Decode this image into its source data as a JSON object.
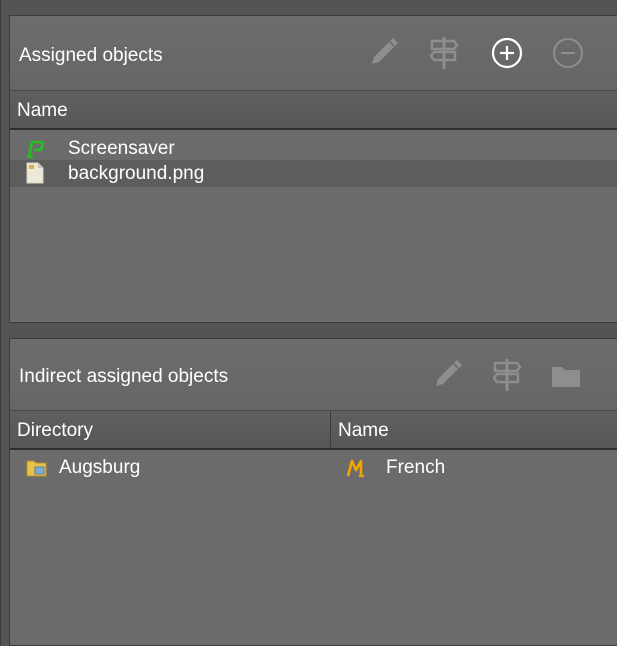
{
  "assigned": {
    "title": "Assigned objects",
    "column_name": "Name",
    "toolbar": [
      {
        "name": "edit-pencil-icon",
        "enabled": false
      },
      {
        "name": "signpost-icon",
        "enabled": false
      },
      {
        "name": "add-circle-icon",
        "enabled": true
      },
      {
        "name": "remove-circle-icon",
        "enabled": false
      }
    ],
    "rows": [
      {
        "icon": "screensaver-p-icon",
        "name": "Screensaver",
        "selected": false
      },
      {
        "icon": "file-image-icon",
        "name": "background.png",
        "selected": true
      }
    ]
  },
  "indirect": {
    "title": "Indirect assigned objects",
    "column_directory": "Directory",
    "column_name": "Name",
    "toolbar": [
      {
        "name": "edit-pencil-icon",
        "enabled": false
      },
      {
        "name": "signpost-icon",
        "enabled": false
      },
      {
        "name": "folder-icon",
        "enabled": false
      }
    ],
    "rows": [
      {
        "dir_icon": "folder-yellow-icon",
        "directory": "Augsburg",
        "name_icon": "menu-m-icon",
        "name": "French"
      }
    ]
  },
  "colors": {
    "background": "#545454",
    "panel": "#6b6b6b",
    "header_bar": "#5b5b5b",
    "selection": "#5d5d5d",
    "text": "#ffffff",
    "disabled_icon": "#8e8e8e",
    "screensaver_green": "#22c022",
    "menu_orange": "#f2a500",
    "folder_yellow": "#e6c34a"
  }
}
